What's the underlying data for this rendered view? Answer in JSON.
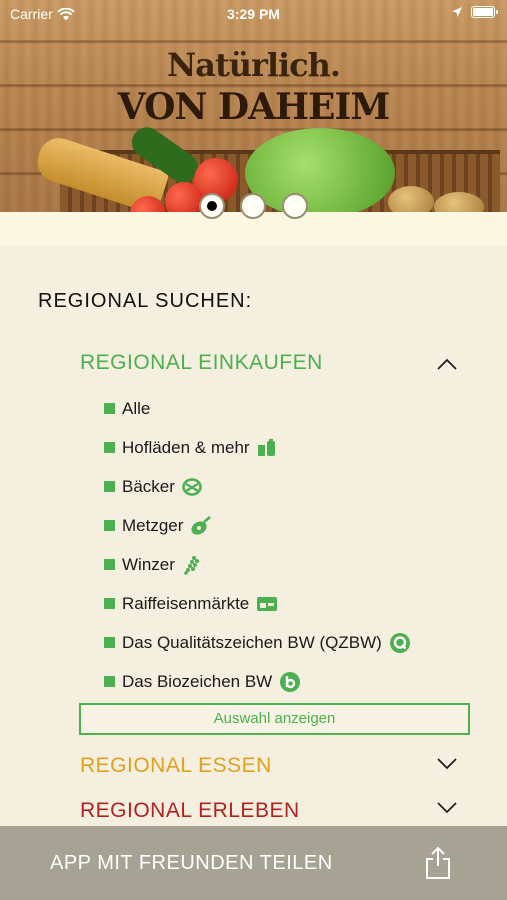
{
  "status": {
    "carrier": "Carrier",
    "time": "3:29 PM"
  },
  "banner": {
    "title_line1": "Natürlich.",
    "title_line2": "VON DAHEIM"
  },
  "carousel": {
    "page_count": 3,
    "active_index": 0
  },
  "search": {
    "heading": "REGIONAL SUCHEN:",
    "sections": [
      {
        "title": "REGIONAL EINKAUFEN",
        "color": "#4caf50",
        "expanded": true,
        "items": [
          {
            "label": "Alle",
            "icon": null
          },
          {
            "label": "Hofläden & mehr",
            "icon": "farm-shop-icon"
          },
          {
            "label": "Bäcker",
            "icon": "pretzel-icon"
          },
          {
            "label": "Metzger",
            "icon": "ham-icon"
          },
          {
            "label": "Winzer",
            "icon": "grapes-icon"
          },
          {
            "label": "Raiffeisenmärkte",
            "icon": "market-icon"
          },
          {
            "label": "Das Qualitätszeichen BW (QZBW)",
            "icon": "qzbw-icon"
          },
          {
            "label": "Das Biozeichen BW",
            "icon": "bio-icon"
          }
        ],
        "button_label": "Auswahl anzeigen"
      },
      {
        "title": "REGIONAL ESSEN",
        "color": "#e0a020",
        "expanded": false
      },
      {
        "title": "REGIONAL ERLEBEN",
        "color": "#b22222",
        "expanded": false
      }
    ]
  },
  "footer": {
    "label": "APP MIT FREUNDEN TEILEN",
    "icon": "share-icon"
  }
}
